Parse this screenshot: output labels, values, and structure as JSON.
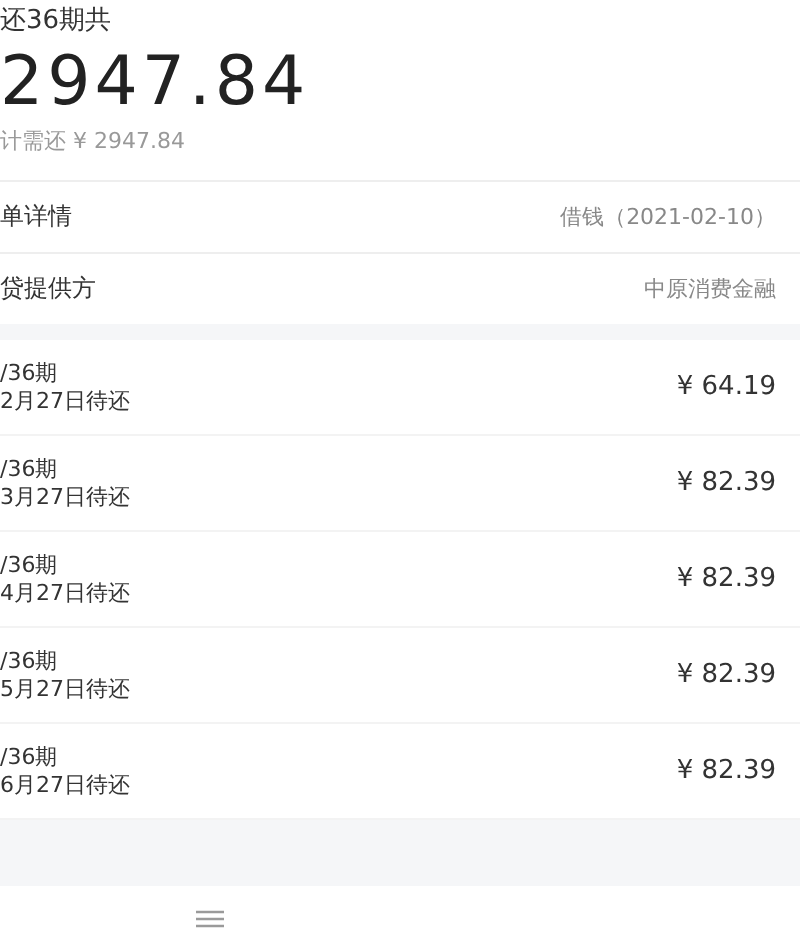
{
  "header": {
    "title": "还36期共",
    "amount": "2947.84",
    "total": "计需还 ¥ 2947.84"
  },
  "info_rows": [
    {
      "label": "单详情",
      "value": "借钱（2021-02-10）"
    },
    {
      "label": "贷提供方",
      "value": "中原消费金融"
    }
  ],
  "installments": [
    {
      "period": "/36期",
      "due": "2月27日待还",
      "amount": "¥ 64.19"
    },
    {
      "period": "/36期",
      "due": "3月27日待还",
      "amount": "¥ 82.39"
    },
    {
      "period": "/36期",
      "due": "4月27日待还",
      "amount": "¥ 82.39"
    },
    {
      "period": "/36期",
      "due": "5月27日待还",
      "amount": "¥ 82.39"
    },
    {
      "period": "/36期",
      "due": "6月27日待还",
      "amount": "¥ 82.39"
    }
  ]
}
